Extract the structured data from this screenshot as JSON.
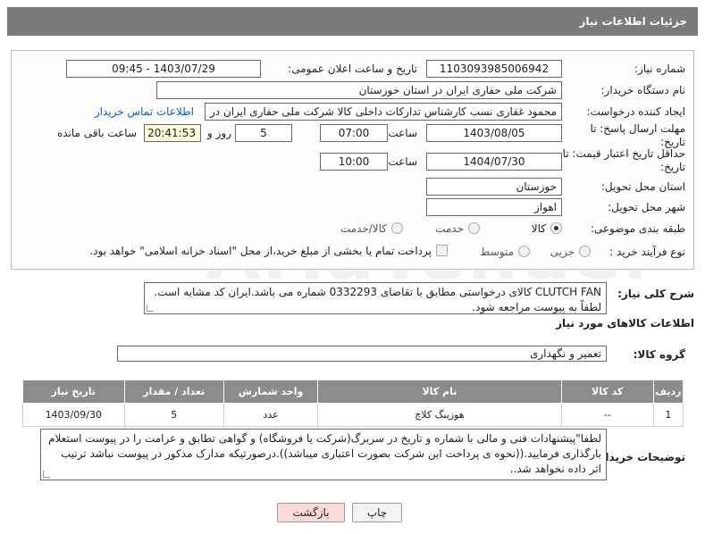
{
  "header": {
    "title": "جزئیات اطلاعات نیاز"
  },
  "form": {
    "need_number_label": "شماره نیاز:",
    "need_number": "1103093985006942",
    "announce_label": "تاریخ و ساعت اعلان عمومی:",
    "announce_value": "1403/07/29 - 09:45",
    "buyer_org_label": "نام دستگاه خریدار:",
    "buyer_org": "شرکت ملی حفاری ایران در استان خوزستان",
    "requester_label": "ایجاد کننده درخواست:",
    "requester": "محمود غفاری نسب کارشناس تدارکات داخلی  کالا شرکت ملی حفاری ایران در",
    "contact_link": "اطلاعات تماس خریدار",
    "reply_deadline_label": "مهلت ارسال پاسخ: تا تاریخ:",
    "reply_date": "1403/08/05",
    "time_label": "ساعت",
    "reply_time": "07:00",
    "days_value": "5",
    "days_label": "روز و",
    "remaining_time": "20:41:53",
    "remaining_label": "ساعت باقی مانده",
    "price_validity_label": "حداقل تاریخ اعتبار قیمت: تا تاریخ:",
    "price_date": "1404/07/30",
    "price_time": "10:00",
    "province_label": "استان محل تحویل:",
    "province": "خوزستان",
    "city_label": "شهر محل تحویل:",
    "city": "اهواز",
    "category_label": "طبقه بندی موضوعی:",
    "category_options": [
      "کالا",
      "خدمت",
      "کالا/خدمت"
    ],
    "purchase_type_label": "نوع فرآیند خرید :",
    "purchase_options": [
      "جزیی",
      "متوسط"
    ],
    "payment_note": "پرداخت تمام یا بخشی از مبلغ خرید،از محل \"اسناد خزانه اسلامی\" خواهد بود."
  },
  "description": {
    "label": "شرح کلی نیاز:",
    "text": "CLUTCH FAN کالای درخواستی مطابق با تقاضای 0332293 شماره می باشد.ایران کد مشابه است. لطفاً به پیوست مراجعه شود."
  },
  "goods": {
    "section_title": "اطلاعات کالاهای مورد نیاز",
    "group_label": "گروه کالا:",
    "group_value": "تعمیر و نگهداری",
    "headers": [
      "ردیف",
      "کد کالا",
      "نام کالا",
      "واحد شمارش",
      "تعداد / مقدار",
      "تاریخ نیاز"
    ],
    "rows": [
      {
        "row": "1",
        "code": "--",
        "name": "هوزینگ کلاچ",
        "unit": "عدد",
        "qty": "5",
        "date": "1403/09/30"
      }
    ]
  },
  "buyer_notes": {
    "label": "توضیحات خریدار:",
    "text": "لطفا\"پیشنهادات فنی و مالی با شماره و تاریخ در سربرگ(شرکت یا فروشگاه) و گواهی تطابق و عرامت را در پیوست استعلام بارگذاری فرمایید.((نحوه ی پرداخت این شرکت بصورت اعتباری میباشد)).درصورتیکه مدارک مذکور در پیوست نباشد ترتیب اثر داده نخواهد شد.."
  },
  "buttons": {
    "print": "چاپ",
    "back": "بازگشت"
  },
  "colors": {
    "titlebar": "#7a7a7a",
    "table_header": "#8c8c8c",
    "link": "#0a5bc4",
    "back_button": "#f9d9d9"
  }
}
